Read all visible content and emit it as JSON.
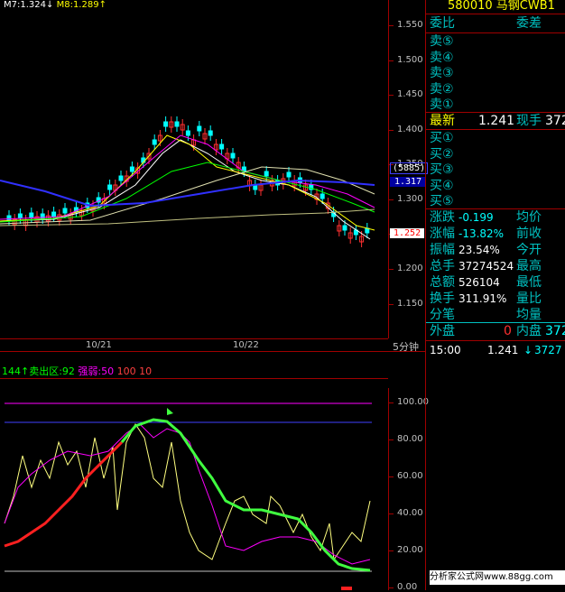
{
  "top_legend": {
    "ma_text": "M7:1.324",
    "ma_arrow": "↓",
    "m8_text": "M8:1.289",
    "m8_arrow": "↑"
  },
  "price_axis": [
    "1.550",
    "1.500",
    "1.450",
    "1.400",
    "1.350",
    "1.300",
    "1.250",
    "1.200",
    "1.150"
  ],
  "crosshair": {
    "volume_box": "(5885)",
    "price_box": "1.317",
    "last_price_box": "1.252"
  },
  "date_axis": [
    "10/21",
    "10/22"
  ],
  "period_label": "5分钟",
  "indicator_header": {
    "prefix": "144↑卖出区:92",
    "strength_label": "强弱:50",
    "v100": "100",
    "v10": "10"
  },
  "indicator_axis": [
    "100.00",
    "80.00",
    "60.00",
    "40.00",
    "20.00",
    "0.00"
  ],
  "quote": {
    "title": "580010 马钢CWB1",
    "header_left": "委比",
    "header_right": "委差",
    "sell_labels": [
      "卖⑤",
      "卖④",
      "卖③",
      "卖②",
      "卖①"
    ],
    "latest_label": "最新",
    "latest_value": "1.241",
    "current_hand_label": "现手",
    "current_hand_value": "372",
    "buy_labels": [
      "买①",
      "买②",
      "买③",
      "买④",
      "买⑤"
    ],
    "stats": [
      {
        "l": "涨跌",
        "v": "-0.199",
        "r": "均价"
      },
      {
        "l": "涨幅",
        "v": "-13.82%",
        "r": "前收"
      },
      {
        "l": "振幅",
        "v": "23.54%",
        "r": "今开"
      },
      {
        "l": "总手",
        "v": "37274524",
        "r": "最高"
      },
      {
        "l": "总额",
        "v": "526104",
        "r": "最低"
      },
      {
        "l": "换手",
        "v": "311.91%",
        "r": "量比"
      },
      {
        "l": "分笔",
        "v": "",
        "r": "均量"
      }
    ],
    "outer_label": "外盘",
    "outer_value": "0",
    "inner_label": "内盘",
    "inner_value": "372",
    "tick_time": "15:00",
    "tick_price": "1.241",
    "tick_arrow": "↓",
    "tick_vol": "3727"
  },
  "watermark": "分析家公式网www.88gg.com",
  "colors": {
    "up": "#ff3030",
    "down": "#00ffff",
    "frame": "#a00000",
    "yellow": "#ffff00",
    "magenta": "#ff00ff",
    "green": "#00ff00"
  }
}
